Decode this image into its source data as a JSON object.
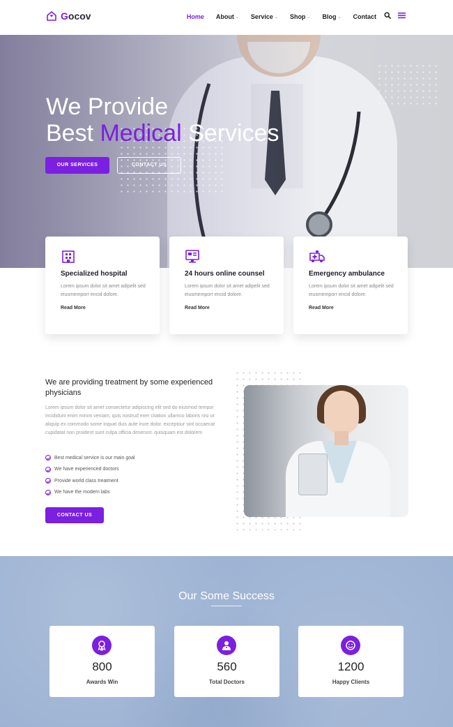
{
  "nav": {
    "logo_text_prefix": "G",
    "logo_text_rest": "ocov",
    "items": [
      {
        "label": "Home",
        "has_caret": false
      },
      {
        "label": "About",
        "has_caret": true
      },
      {
        "label": "Service",
        "has_caret": true
      },
      {
        "label": "Shop",
        "has_caret": true
      },
      {
        "label": "Blog",
        "has_caret": true
      },
      {
        "label": "Contact",
        "has_caret": false
      }
    ],
    "icons": [
      "search-icon",
      "hamburger-menu-icon"
    ]
  },
  "hero": {
    "line1": "We Provide",
    "line2_prefix": "Best ",
    "line2_accent": "Medical",
    "line2_suffix": " Services",
    "primary_button": "OUR SERVICES",
    "secondary_button": "CONTACT US"
  },
  "features": [
    {
      "icon": "hospital-icon",
      "title": "Specialized hospital",
      "text": "Lorem ipsum dolor sit amet adipelit sed eiusmemporr encid dolore.",
      "link": "Read More"
    },
    {
      "icon": "monitor-icon",
      "title": "24 hours online counsel",
      "text": "Lorem ipsum dolor sit amet adipelit sed eiusmemporr encid dolore.",
      "link": "Read More"
    },
    {
      "icon": "ambulance-icon",
      "title": "Emergency ambulance",
      "text": "Lorem ipsum dolor sit amet adipelit sed eiusmemporr encid dolore.",
      "link": "Read More"
    }
  ],
  "about": {
    "title": "We are providing treatment by some experienced physicians",
    "body": "Lorem ipsum dolor sit amet consectetur adipiscing elit sed do eiusmod tempor incididunt enim minim veniam, quis nostrud exer citation ullamco laboris nisi ut aliquip ex commodo some inquat duis aute irure dolor. exceptour sint occaecat cupidatat non proident sunt culpa officia deserunt. quisquam est dolorem",
    "checklist": [
      "Best medical service is our main goal",
      "We have experienced doctors",
      "Provide world class treatment",
      "We have the modern labs"
    ],
    "button": "CONTACT US"
  },
  "success": {
    "title": "Our Some Success",
    "stats": [
      {
        "icon": "award-icon",
        "value": "800",
        "label": "Awards Win"
      },
      {
        "icon": "doctor-icon",
        "value": "560",
        "label": "Total Doctors"
      },
      {
        "icon": "smile-icon",
        "value": "1200",
        "label": "Happy Clients"
      }
    ]
  },
  "colors": {
    "accent": "#7b1fe0",
    "success_bg": "#9db3d3"
  }
}
